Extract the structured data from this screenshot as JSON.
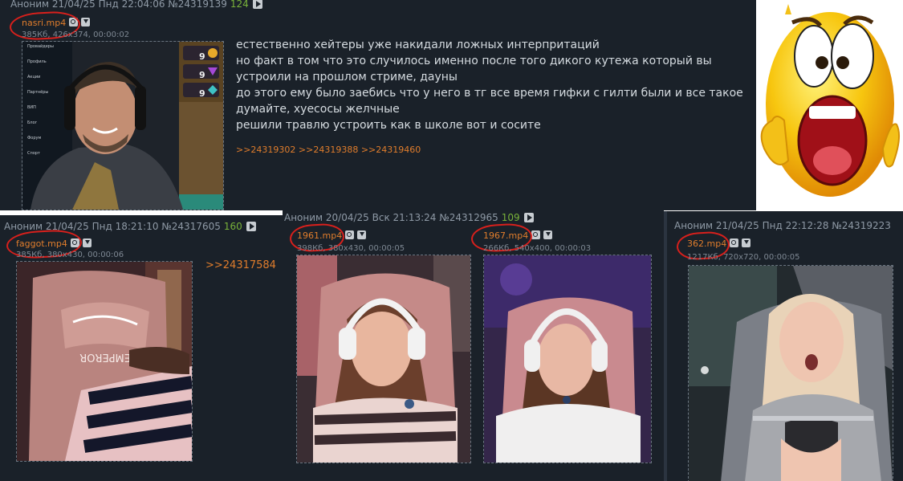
{
  "colors": {
    "panel_bg": "#1a2129",
    "link": "#e07d2c",
    "reply_count": "#79b23a",
    "annotation_red": "#d8201c"
  },
  "posts": {
    "top": {
      "header": "Аноним 21/04/25 Пнд 22:04:06 №24319139",
      "reply_count": "124",
      "file": {
        "name": "nasri.mp4",
        "meta": "385Кб, 426x374, 00:00:02"
      },
      "message": [
        "естественно хейтеры уже накидали ложных интерпритаций",
        "но факт в том что это случилось именно после того дикого кутежа который вы устроили на прошлом стриме, дауны",
        "до этого ему было заебись что у него в тг все время гифки с гилти были и все такое думайте, хуесосы желчные",
        "решили травлю устроить как в школе вот и сосите"
      ],
      "reply_links": [
        ">>24319302",
        ">>24319388",
        ">>24319460"
      ],
      "overlay_menu": [
        "Провайдеры",
        "Профиль",
        "Акции",
        "Партнёры",
        "ВИП",
        "Блог",
        "Форум",
        "Спорт"
      ],
      "overlay_badges": [
        "9",
        "9",
        "9"
      ]
    },
    "left": {
      "header": "Аноним 21/04/25 Пнд 18:21:10 №24317605",
      "reply_count": "160",
      "file": {
        "name": "faggot.mp4",
        "meta": "385Кб, 380x430, 00:00:06"
      },
      "reply_link": ">>24317584",
      "chair_text": "EMPEROR"
    },
    "middle": {
      "header": "Аноним 20/04/25 Вск 21:13:24 №24312965",
      "reply_count": "109",
      "files": [
        {
          "name": "1961.mp4",
          "meta": "398Кб, 380x430, 00:00:05"
        },
        {
          "name": "1967.mp4",
          "meta": "266Кб, 540x400, 00:00:03"
        }
      ]
    },
    "right": {
      "header": "Аноним 21/04/25 Пнд 22:12:28 №24319223",
      "file": {
        "name": "362.mp4",
        "meta": "1217Кб, 720x720, 00:00:05"
      }
    }
  },
  "emoji": {
    "icon": "screaming-emoji-icon"
  }
}
